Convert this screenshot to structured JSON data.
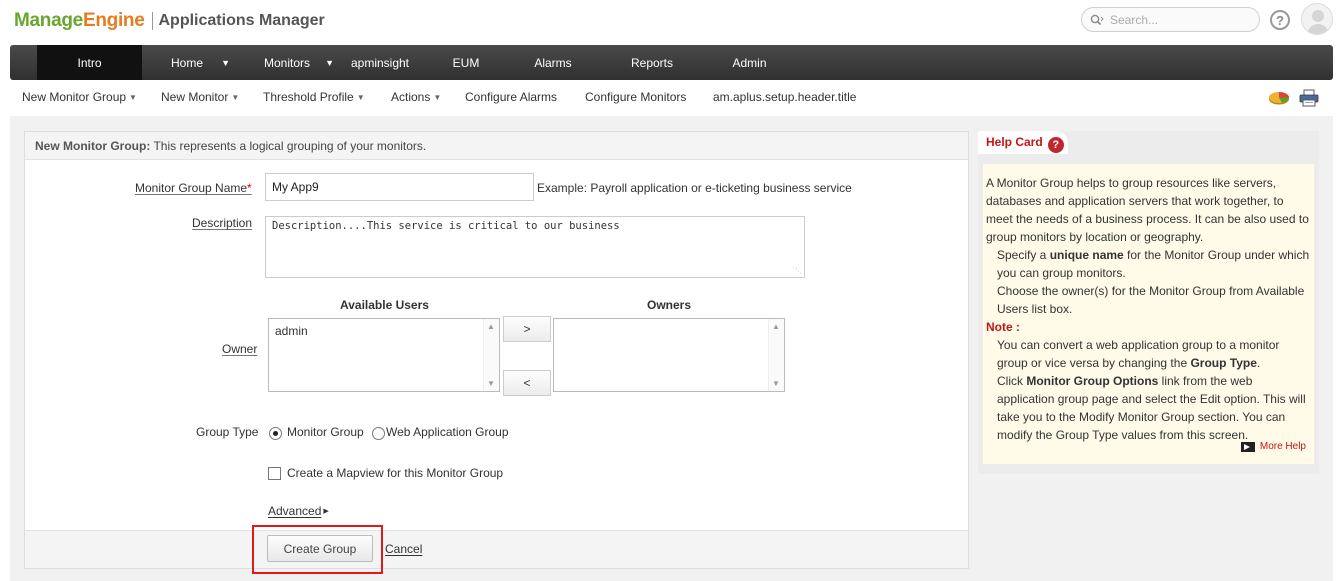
{
  "header": {
    "logo_manage": "Manage",
    "logo_engine": "Engine",
    "app_title": "Applications Manager",
    "search_placeholder": "Search..."
  },
  "main_nav": [
    {
      "label": "Intro",
      "active": true
    },
    {
      "label": "Home",
      "dropdown": true
    },
    {
      "label": "Monitors",
      "dropdown": true
    },
    {
      "label": "apminsight"
    },
    {
      "label": "EUM"
    },
    {
      "label": "Alarms"
    },
    {
      "label": "Reports"
    },
    {
      "label": "Admin"
    }
  ],
  "sub_nav": [
    {
      "label": "New Monitor Group",
      "dropdown": true
    },
    {
      "label": "New Monitor",
      "dropdown": true
    },
    {
      "label": "Threshold Profile",
      "dropdown": true
    },
    {
      "label": "Actions",
      "dropdown": true
    },
    {
      "label": "Configure Alarms"
    },
    {
      "label": "Configure Monitors"
    },
    {
      "label": "am.aplus.setup.header.title"
    }
  ],
  "form": {
    "header_bold": "New Monitor Group:",
    "header_text": " This represents a logical grouping of your monitors.",
    "name_label": "Monitor Group Name",
    "required_mark": "*",
    "name_value": "My App9",
    "name_example": "Example: Payroll application or e-ticketing business service",
    "description_label": "Description",
    "description_value": "Description....This service is critical to our business",
    "owner_label": "Owner",
    "available_users_title": "Available Users",
    "owners_title": "Owners",
    "available_users": [
      "admin"
    ],
    "owners": [],
    "move_right": ">",
    "move_left": "<",
    "group_type_label": "Group Type",
    "group_type_options": [
      {
        "label": "Monitor Group",
        "selected": true
      },
      {
        "label": "Web Application Group",
        "selected": false
      }
    ],
    "mapview_label": "Create a Mapview for this Monitor Group",
    "mapview_checked": false,
    "advanced_label": "Advanced",
    "create_button": "Create Group",
    "cancel_link": "Cancel",
    "highlight_color": "#e01a1a"
  },
  "help_card": {
    "title": "Help Card",
    "line1": "A Monitor Group helps to group resources like servers, databases and application servers that work together, to meet the needs of a business process. It can be also used to group monitors by location or geography.",
    "spec_pre": "Specify a ",
    "spec_bold": "unique name",
    "spec_post": " for the Monitor Group under which you can group monitors.",
    "owner_text": "Choose the owner(s) for the Monitor Group from Available Users list box.",
    "note_label": "Note :",
    "note1_pre": "You can convert a web application group to a monitor group or vice versa by changing the ",
    "note1_bold": "Group Type",
    "note1_post": ".",
    "note2_pre": "Click ",
    "note2_bold": "Monitor Group Options",
    "note2_post": " link from the web application group page and select the Edit option. This will take you to the Modify Monitor Group section. You can modify the Group Type values from this screen.",
    "more_help": "More Help"
  },
  "colors": {
    "accent_red": "#c31616",
    "logo_green": "#6aa62f",
    "logo_orange": "#e97b1f",
    "nav_bg": "#3a3a3a",
    "help_bg": "#fffbe8"
  }
}
